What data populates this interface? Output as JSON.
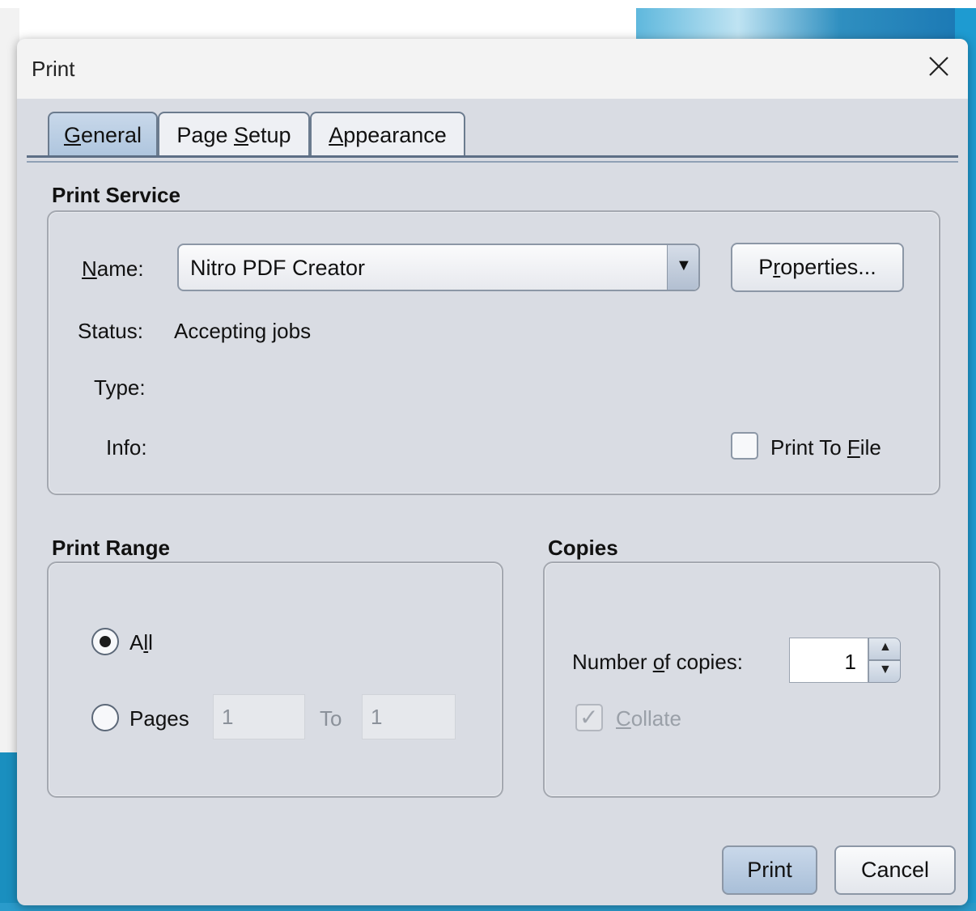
{
  "dialog": {
    "title": "Print",
    "close_icon": "close-icon"
  },
  "tabs": [
    {
      "label_pre": "",
      "label_u": "G",
      "label_post": "eneral",
      "active": true
    },
    {
      "label_pre": "Page ",
      "label_u": "S",
      "label_post": "etup",
      "active": false
    },
    {
      "label_pre": "",
      "label_u": "A",
      "label_post": "ppearance",
      "active": false
    }
  ],
  "print_service": {
    "heading": "Print Service",
    "name_label_u": "N",
    "name_label_rest": "ame:",
    "printer_name": "Nitro PDF Creator",
    "properties_pre": "P",
    "properties_u": "r",
    "properties_post": "operties...",
    "status_label": "Status:",
    "status_value": "Accepting jobs",
    "type_label": "Type:",
    "info_label": "Info:",
    "print_to_file_pre": "Print To ",
    "print_to_file_u": "F",
    "print_to_file_post": "ile",
    "print_to_file_checked": false
  },
  "print_range": {
    "heading": "Print Range",
    "all_pre": "A",
    "all_u": "l",
    "all_post": "l",
    "all_selected": true,
    "pages_pre": "Pa",
    "pages_u": "g",
    "pages_post": "es",
    "from_value": "1",
    "to_label": "To",
    "to_value": "1"
  },
  "copies": {
    "heading": "Copies",
    "number_pre": "Number ",
    "number_u": "o",
    "number_post": "f copies:",
    "count": "1",
    "collate_u": "C",
    "collate_post": "ollate",
    "collate_checked": true,
    "collate_enabled": false
  },
  "buttons": {
    "print": "Print",
    "cancel": "Cancel"
  }
}
